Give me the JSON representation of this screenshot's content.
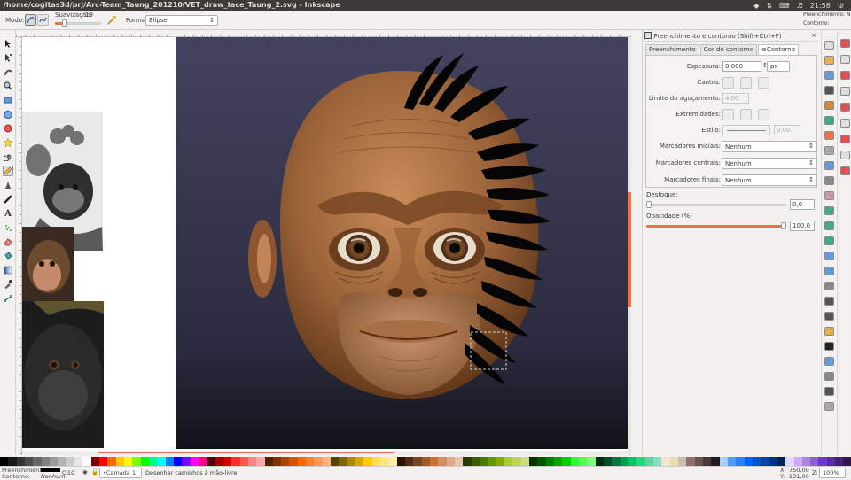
{
  "window": {
    "title": "/home/cogitas3d/prj/Arc-Team_Taung_201210/VET_draw_face_Taung_2.svg - Inkscape"
  },
  "system_tray": {
    "clock": "21:58"
  },
  "tool_controls": {
    "mode_label": "Modo:",
    "smoothing_label": "Suavização:",
    "smoothing_value": "19",
    "shape_label": "Forma:",
    "shape_value": "Elipse"
  },
  "style_indicator": {
    "fill_label": "Preenchimento:",
    "stroke_label": "Contorno:",
    "fill_short": "Preenchimento: N",
    "stroke_short": "Contorno:"
  },
  "dock": {
    "title": "Preenchimento e contorno (Shift+Ctrl+F)",
    "tabs": [
      {
        "label": "Preenchimento"
      },
      {
        "label": "Cor do contorno"
      },
      {
        "label": "Contorno"
      }
    ],
    "stroke_width_label": "Espessura:",
    "stroke_width_value": "0,000",
    "stroke_unit": "px",
    "corners_label": "Cantos:",
    "miter_label": "Limite do aguçamento:",
    "miter_value": "4,00",
    "caps_label": "Extremidades:",
    "dash_label": "Estilo:",
    "dash_value": "0,00",
    "start_markers_label": "Marcadores iniciais:",
    "start_markers_value": "Nenhum",
    "mid_markers_label": "Marcadores centrais:",
    "mid_markers_value": "Nenhum",
    "end_markers_label": "Marcadores finais:",
    "end_markers_value": "Nenhum",
    "blur_label": "Desfoque:",
    "blur_value": "0,0",
    "blur_fraction": 0.0,
    "opacity_label": "Opacidade (%)",
    "opacity_value": "100,0",
    "opacity_fraction": 1.0
  },
  "statusbar": {
    "fill_label": "Preenchimento:",
    "stroke_label": "Contorno:",
    "stroke_value": "Nenhum",
    "opacity_label": "O:",
    "opacity_value": "1C",
    "layer": "•Camada 1",
    "message": "Desenhar caminhos à mão-livre",
    "x_label": "X:",
    "x_value": "750,00",
    "y_label": "Y:",
    "y_value": "231,00",
    "zoom_label": "Z:",
    "zoom_value": "100%"
  },
  "colors": {
    "accent": "#e9734a",
    "titlebar": "#3c3b37",
    "background_top": "#43435f",
    "background_bottom": "#1a1a26",
    "skin": "#b07040"
  },
  "palette": [
    "#000000",
    "#1a1a1a",
    "#333333",
    "#4d4d4d",
    "#666666",
    "#808080",
    "#999999",
    "#b3b3b3",
    "#cccccc",
    "#e6e6e6",
    "#ffffff",
    "#800000",
    "#ff0000",
    "#ff6600",
    "#ffcc00",
    "#ffff00",
    "#80ff00",
    "#00ff00",
    "#00ff80",
    "#00ffff",
    "#0080ff",
    "#0000ff",
    "#8000ff",
    "#ff00ff",
    "#ff0080",
    "#550000",
    "#aa0000",
    "#d40000",
    "#ff2a2a",
    "#ff5555",
    "#ff8080",
    "#ffaaaa",
    "#552200",
    "#803300",
    "#aa4400",
    "#d45500",
    "#ff6600",
    "#ff7f2a",
    "#ff9955",
    "#ffb380",
    "#554400",
    "#806600",
    "#aa8800",
    "#d4aa00",
    "#ffcc00",
    "#ffdd55",
    "#ffe680",
    "#ffeeaa",
    "#2b1100",
    "#502d16",
    "#784421",
    "#a05a2c",
    "#c87137",
    "#d38d5f",
    "#deaa87",
    "#e9c6af",
    "#283b00",
    "#3c5a00",
    "#4f7800",
    "#669900",
    "#88aa00",
    "#abc837",
    "#bcd35f",
    "#cdde87",
    "#003300",
    "#005500",
    "#008000",
    "#00aa00",
    "#00d400",
    "#2aff2a",
    "#55ff55",
    "#80ff80",
    "#002b11",
    "#00502d",
    "#007841",
    "#00a050",
    "#00c864",
    "#2ad47f",
    "#5fd3a0",
    "#87debd",
    "#f4e3d7",
    "#e9ddaf",
    "#c8beb7",
    "#916f6f",
    "#6c5353",
    "#483737",
    "#241c1c",
    "#aaccff",
    "#5599ff",
    "#2a7fff",
    "#0066ff",
    "#0055d4",
    "#0044aa",
    "#003380",
    "#002255",
    "#e5d5ff",
    "#ccaaff",
    "#aa87de",
    "#8d5fd3",
    "#7137c8",
    "#5a2ca0",
    "#442178",
    "#2d1650"
  ],
  "icons": {
    "toolbox": [
      "selector-arrow-icon",
      "node-edit-icon",
      "tweak-icon",
      "zoom-icon",
      "rectangle-icon",
      "box3d-icon",
      "ellipse-icon",
      "star-icon",
      "spiral-icon",
      "pencil-icon",
      "pen-icon",
      "calligraphy-icon",
      "text-icon",
      "spray-icon",
      "eraser-icon",
      "bucket-icon",
      "gradient-icon",
      "dropper-icon",
      "connector-icon"
    ],
    "commands": [
      "new-document-icon",
      "open-icon",
      "save-icon",
      "print-icon",
      "import-icon",
      "export-icon",
      "undo-icon",
      "redo-icon",
      "copy-icon",
      "cut-icon",
      "paste-icon",
      "zoom-selection-icon",
      "zoom-drawing-icon",
      "zoom-page-icon",
      "duplicate-icon",
      "clone-icon",
      "unlink-clone-icon",
      "group-icon",
      "ungroup-icon",
      "fill-stroke-icon",
      "text-font-icon",
      "layers-icon",
      "xml-editor-icon",
      "align-icon",
      "preferences-icon"
    ]
  }
}
